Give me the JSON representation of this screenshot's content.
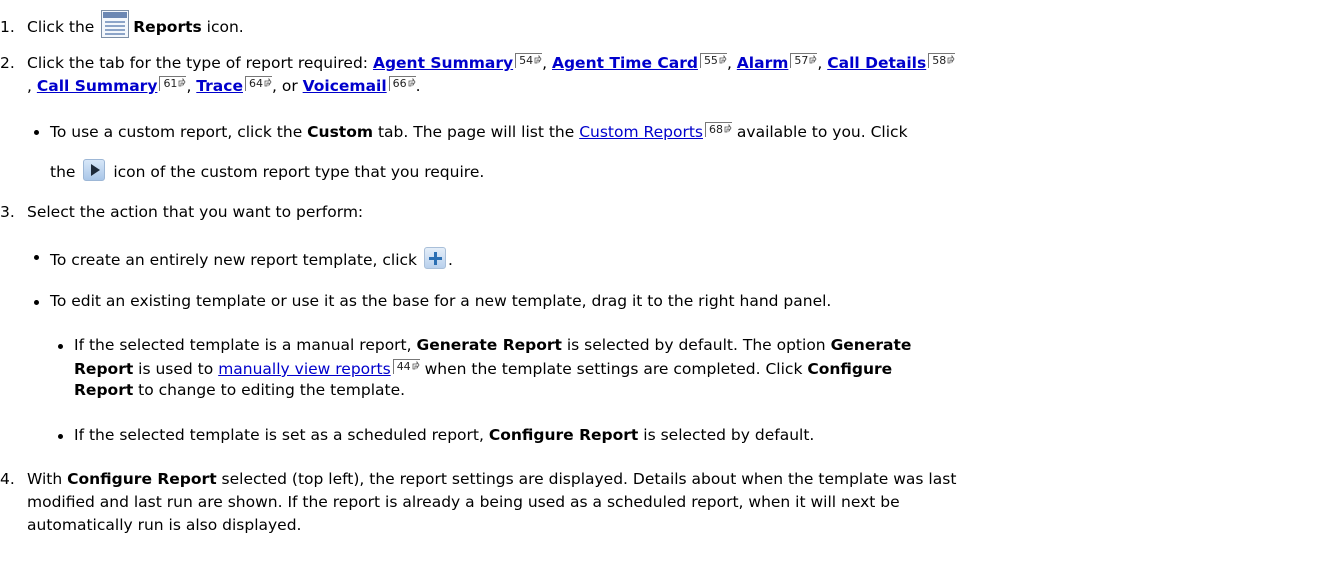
{
  "step1": {
    "num": "1.",
    "pre": "Click the",
    "bold": "Reports",
    "post": "icon."
  },
  "step2": {
    "num": "2.",
    "pre": "Click the tab for the type of report required: ",
    "links": [
      {
        "text": "Agent Summary",
        "page": "54"
      },
      {
        "text": "Agent Time Card",
        "page": "55"
      },
      {
        "text": "Alarm",
        "page": "57"
      },
      {
        "text": "Call Details",
        "page": "58"
      },
      {
        "text": "Call Summary",
        "page": "61"
      },
      {
        "text": "Trace",
        "page": "64"
      },
      {
        "text": "Voicemail",
        "page": "66"
      }
    ],
    "sep": ", ",
    "or": ", or ",
    "end": "."
  },
  "custom_bullet": {
    "pre": "To use a custom report, click the ",
    "bold": "Custom",
    "mid": " tab. The page will list the ",
    "link": "Custom Reports",
    "page": "68",
    "post": " available to you. Click",
    "line2_pre": "the",
    "line2_post": "icon of the custom report type that you require."
  },
  "step3": {
    "num": "3.",
    "text": "Select the action that you want to perform:"
  },
  "bullet_new": {
    "pre": "To create an entirely new report template, click",
    "post": "."
  },
  "bullet_edit": {
    "text": "To edit an existing template or use it as the base for a new template, drag it to the right hand panel."
  },
  "sub_manual": {
    "l1_pre": "If the selected template is a manual report, ",
    "l1_bold": "Generate Report",
    "l1_mid": " is selected by default. The option ",
    "l1_bold2": "Generate",
    "l2_bold": "Report",
    "l2_pre": " is used to ",
    "l2_link": "manually view reports",
    "l2_page": "44",
    "l2_post": " when the template settings are completed. Click ",
    "l2_bold2": "Configure",
    "l3_bold": "Report",
    "l3_post": " to change to editing the template."
  },
  "sub_scheduled": {
    "pre": "If the selected template is set as a scheduled report, ",
    "bold": "Configure Report",
    "post": " is selected by default."
  },
  "step4": {
    "num": "4.",
    "pre": "With ",
    "bold": "Configure Report",
    "l1_post": " selected (top left), the report settings are displayed. Details about when the template was last",
    "l2": "modified and last run are shown. If the report is already a being used as a scheduled report, when it will next be",
    "l3": "automatically run is also displayed."
  }
}
